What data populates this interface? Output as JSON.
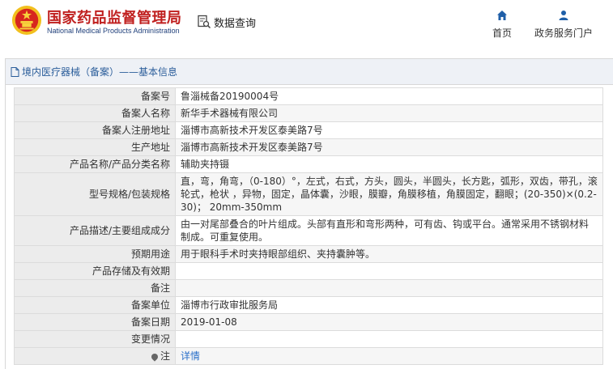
{
  "header": {
    "logo_cn": "国家药品监督管理局",
    "logo_en": "National Medical Products Administration",
    "emblem_icon": "national-emblem-icon",
    "query_label": "数据查询",
    "nav": [
      {
        "label": "首页",
        "icon": "home-icon"
      },
      {
        "label": "政务服务门户",
        "icon": "user-icon"
      }
    ]
  },
  "panel": {
    "title": "境内医疗器械（备案）——基本信息"
  },
  "rows": [
    {
      "label": "备案号",
      "value": "鲁淄械备20190004号"
    },
    {
      "label": "备案人名称",
      "value": "新华手术器械有限公司"
    },
    {
      "label": "备案人注册地址",
      "value": "淄博市高新技术开发区泰美路7号"
    },
    {
      "label": "生产地址",
      "value": "淄博市高新技术开发区泰美路7号"
    },
    {
      "label": "产品名称/产品分类名称",
      "value": "辅助夹持镊"
    },
    {
      "label": "型号规格/包装规格",
      "value": "直，弯，角弯，（0-180）°，左式，右式，方头，圆头，半圆头，长方匙，弧形，双齿，带孔，滚轮式，枪状 ，异物，固定，晶体囊，沙眼，膜瓣，角膜移植，角膜固定，翻眼；(20-350)×(0.2-30)； 20mm-350mm"
    },
    {
      "label": "产品描述/主要组成成分",
      "value": "由一对尾部叠合的叶片组成。头部有直形和弯形两种，可有齿、钩或平台。通常采用不锈钢材料制成。可重复使用。"
    },
    {
      "label": "预期用途",
      "value": "用于眼科手术时夹持眼部组织、夹持囊肿等。"
    },
    {
      "label": "产品存储及有效期",
      "value": ""
    },
    {
      "label": "备注",
      "value": ""
    },
    {
      "label": "备案单位",
      "value": "淄博市行政审批服务局"
    },
    {
      "label": "备案日期",
      "value": "2019-01-08"
    },
    {
      "label": "变更情况",
      "value": ""
    },
    {
      "label": "注",
      "value": "详情",
      "label_icon": "pin-icon"
    }
  ],
  "colors": {
    "brand_red": "#c0201f",
    "brand_blue": "#1f3f7a",
    "link_blue": "#2a6fc9",
    "title_blue": "#2a5d9a"
  }
}
